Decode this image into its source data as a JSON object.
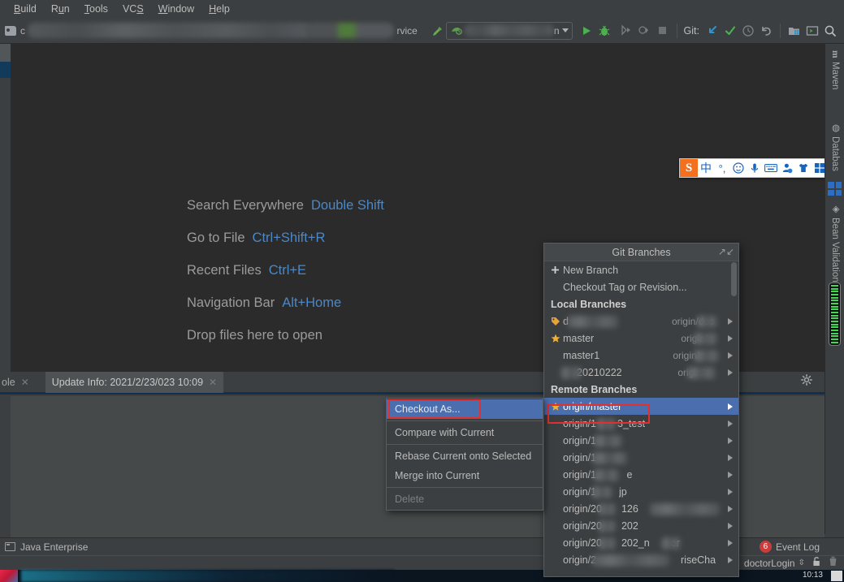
{
  "menubar": {
    "items": [
      {
        "label": "Build",
        "mnemonic": "B"
      },
      {
        "label": "Run",
        "mnemonic": "u"
      },
      {
        "label": "Tools",
        "mnemonic": "T"
      },
      {
        "label": "VCS",
        "mnemonic": "S"
      },
      {
        "label": "Window",
        "mnemonic": "W"
      },
      {
        "label": "Help",
        "mnemonic": "H"
      }
    ]
  },
  "toolbar": {
    "breadcrumb_text": "c",
    "service_text": "rvice",
    "run_config_text": "n",
    "git_label": "Git:",
    "icons": {
      "build": "hammer-icon",
      "run": "run-icon",
      "debug": "debug-icon",
      "run_with_coverage": "run-coverage-icon",
      "profile": "profile-icon",
      "stop": "stop-icon",
      "update_project": "update-project-icon",
      "commit": "commit-icon",
      "history": "history-icon",
      "rollback": "rollback-icon",
      "project_structure": "project-structure-icon",
      "terminal": "terminal-icon",
      "search": "search-icon"
    }
  },
  "editor": {
    "hints": [
      {
        "name": "Search Everywhere",
        "key": "Double Shift"
      },
      {
        "name": "Go to File",
        "key": "Ctrl+Shift+R"
      },
      {
        "name": "Recent Files",
        "key": "Ctrl+E"
      },
      {
        "name": "Navigation Bar",
        "key": "Alt+Home"
      },
      {
        "name": "Drop files here to open",
        "key": ""
      }
    ]
  },
  "ime": {
    "logo": "S",
    "mode": "中",
    "punctuation": "°,",
    "buttons": [
      "sogou-logo-icon",
      "chinese-mode-icon",
      "punctuation-icon",
      "emoji-icon",
      "voice-input-icon",
      "soft-keyboard-icon",
      "user-icon",
      "skin-icon",
      "toolbox-icon"
    ]
  },
  "toolwindow": {
    "tabs": [
      {
        "label": "ole",
        "active": false
      },
      {
        "label": "Update Info: 2021/2/23/023 10:09",
        "active": true
      }
    ],
    "settings_icon": "gear-icon",
    "minimize_icon": "minimize-icon"
  },
  "context_menu": {
    "items": [
      {
        "label": "Checkout As...",
        "state": "selected"
      },
      {
        "label": "Compare with Current",
        "state": "normal"
      },
      {
        "label": "Rebase Current onto Selected",
        "state": "normal"
      },
      {
        "label": "Merge into Current",
        "state": "normal"
      },
      {
        "label": "Delete",
        "state": "disabled"
      }
    ]
  },
  "git_branches": {
    "title": "Git Branches",
    "collapse_icon": "collapse-icon",
    "actions": [
      {
        "label": "New Branch",
        "icon": "plus-icon"
      },
      {
        "label": "Checkout Tag or Revision...",
        "icon": ""
      }
    ],
    "local_header": "Local Branches",
    "local": [
      {
        "name": "d",
        "icon": "tag-icon",
        "tracking": "origin/doc",
        "tracking_suffix": "o...",
        "blurred": true
      },
      {
        "name": "master",
        "icon": "star-icon",
        "tracking": "origin/",
        "tracking_suffix": "r",
        "blurred": true
      },
      {
        "name": "master1",
        "icon": "",
        "tracking": "origin/m",
        "tracking_suffix": "",
        "blurred": true
      },
      {
        "name": "20210222",
        "icon": "",
        "tracking": "origin/",
        "tracking_suffix": "...",
        "blurred": true
      }
    ],
    "remote_header": "Remote Branches",
    "remote": [
      {
        "name": "origin/master",
        "icon": "star-icon",
        "selected": true,
        "blurred": false
      },
      {
        "name": "origin/1",
        "suffix": "3_test",
        "selected": false,
        "blurred": true
      },
      {
        "name": "origin/1",
        "suffix": "",
        "selected": false,
        "blurred": true
      },
      {
        "name": "origin/1",
        "suffix": "",
        "selected": false,
        "blurred": true
      },
      {
        "name": "origin/1.",
        "suffix": "e",
        "selected": false,
        "blurred": true
      },
      {
        "name": "origin/1",
        "suffix": "jp",
        "selected": false,
        "blurred": true
      },
      {
        "name": "origin/20",
        "suffix": "126",
        "selected": false,
        "blurred": true
      },
      {
        "name": "origin/20",
        "suffix": "202",
        "selected": false,
        "blurred": true
      },
      {
        "name": "origin/20",
        "suffix": "202_n",
        "suffix2": "er",
        "selected": false,
        "blurred": true
      },
      {
        "name": "origin/2",
        "suffix": "riseCha",
        "selected": false,
        "blurred": true
      }
    ]
  },
  "right_sidebar": {
    "items": [
      {
        "label": "Maven",
        "icon": "maven-icon"
      },
      {
        "label": "Databas",
        "icon": "database-icon"
      },
      {
        "label": "Bean Validation",
        "icon": "bean-validation-icon"
      }
    ],
    "toolbox_icon": "toolbox-grid-icon",
    "memory_gauge": "memory-indicator"
  },
  "statusbar": {
    "facet_label": "Java Enterprise",
    "facet_icon": "java-enterprise-icon",
    "event_log_label": "Event Log",
    "event_log_count": "6",
    "branch_label": "doctorLogin",
    "lock_icon": "unlock-icon",
    "trash_icon": "trash-icon"
  },
  "taskbar": {
    "clock": "10:13"
  },
  "colors": {
    "accent_blue": "#4b6eaf",
    "link_blue": "#4a88c7",
    "annotation_red": "#e03030",
    "panel_bg": "#3c3f41",
    "editor_bg": "#2b2b2b",
    "star_yellow": "#f0b132"
  }
}
